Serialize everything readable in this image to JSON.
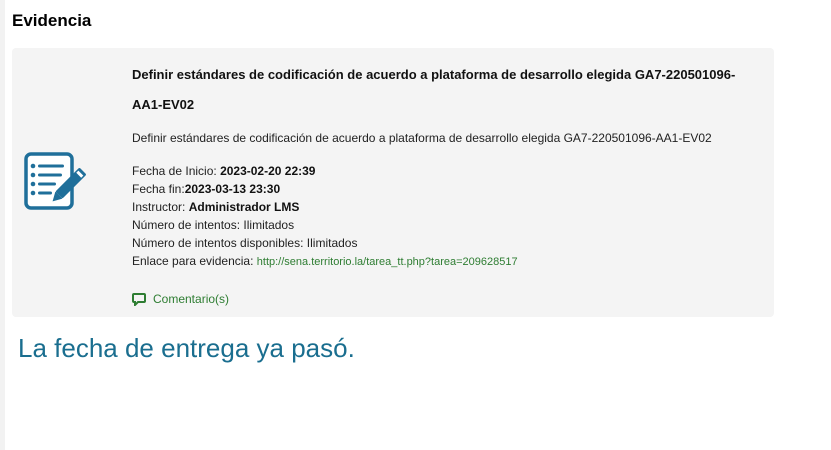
{
  "section": {
    "title": "Evidencia"
  },
  "evidence": {
    "title": "Definir estándares de codificación de acuerdo a plataforma de desarrollo elegida GA7-220501096-AA1-EV02",
    "description": "Definir estándares de codificación de acuerdo a plataforma de desarrollo elegida GA7-220501096-AA1-EV02",
    "icon": "document-edit-icon",
    "start_date_label": "Fecha de Inicio:",
    "start_date_value": "2023-02-20 22:39",
    "end_date_label": "Fecha fin:",
    "end_date_value": "2023-03-13 23:30",
    "instructor_label": "Instructor:",
    "instructor_value": "Administrador LMS",
    "attempts_label": "Número de intentos:",
    "attempts_value": "Ilimitados",
    "available_attempts_label": "Número de intentos disponibles:",
    "available_attempts_value": "Ilimitados",
    "link_label": "Enlace para evidencia:",
    "link_value": "http://sena.territorio.la/tarea_tt.php?tarea=209628517",
    "comments_label": "Comentario(s)",
    "comments_icon": "comment-icon"
  },
  "notice": {
    "text": "La fecha de entrega ya pasó."
  },
  "colors": {
    "card_background": "#f4f4f4",
    "link_green": "#2e7d32",
    "notice_blue": "#1a6e8f",
    "icon_blue": "#1f6f9a"
  }
}
